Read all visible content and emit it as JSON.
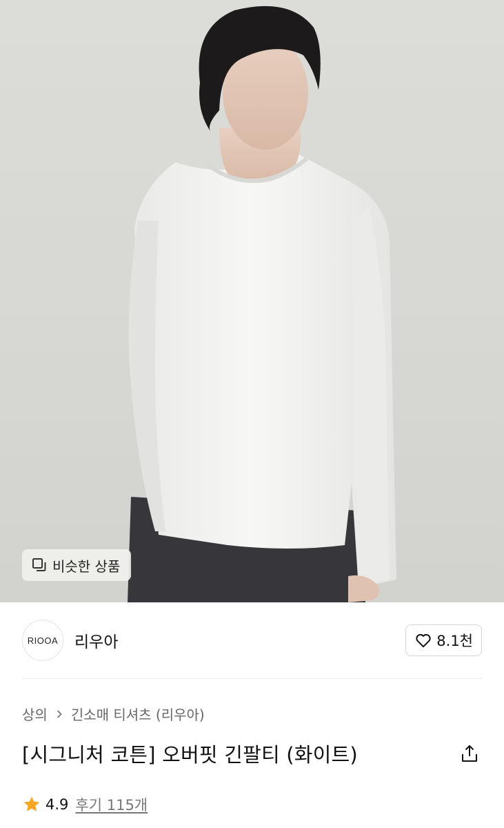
{
  "product_image": {
    "similar_button_label": "비슷한 상품",
    "similar_icon": "copy-squares-icon"
  },
  "brand": {
    "logo_text": "RIOOA",
    "name": "리우아",
    "like_icon": "heart-outline-icon",
    "like_count": "8.1천"
  },
  "breadcrumb": {
    "category": "상의",
    "separator_icon": "chevron-right-icon",
    "subcategory": "긴소매 티셔츠 (리우아)"
  },
  "product": {
    "title": "[시그니처 코튼] 오버핏 긴팔티 (화이트)",
    "share_icon": "share-upload-icon"
  },
  "rating": {
    "star_icon": "star-icon",
    "star_color": "#f5a623",
    "value": "4.9",
    "review_label": "후기 115개"
  }
}
